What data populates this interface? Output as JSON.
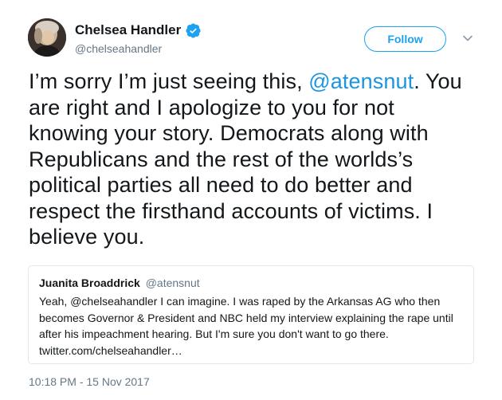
{
  "author": {
    "display_name": "Chelsea Handler",
    "handle": "@chelseahandler",
    "verified_icon": "verified-badge-icon"
  },
  "actions": {
    "follow_label": "Follow",
    "more_icon": "chevron-down-icon"
  },
  "tweet": {
    "lines": [
      {
        "before": "I’m sorry I’m just seeing this, ",
        "mention": "@atensnut",
        "after": ". You"
      },
      {
        "text": "are right and I apologize to you for not"
      },
      {
        "text": "knowing your story. Democrats along with"
      },
      {
        "text": "Republicans and the rest of the worlds’s"
      },
      {
        "text": "political parties all need to do better and"
      },
      {
        "text": "respect the firsthand accounts of victims. I"
      },
      {
        "text": "believe you."
      }
    ]
  },
  "quoted_tweet": {
    "display_name": "Juanita Broaddrick",
    "handle": "@atensnut",
    "lines": [
      "Yeah, @chelseahandler I can imagine. I was raped by the Arkansas AG who then",
      "becomes Governor  & President and NBC held my interview explaining the rape until",
      "after his impeachment hearing.  But I'm sure you don't want to go there.",
      "twitter.com/chelseahandler…"
    ]
  },
  "timestamp": "10:18 PM - 15 Nov 2017",
  "colors": {
    "link": "#1b95e0",
    "follow": "#1da1f2",
    "secondary_text": "#657786",
    "border": "#e1e8ed"
  }
}
